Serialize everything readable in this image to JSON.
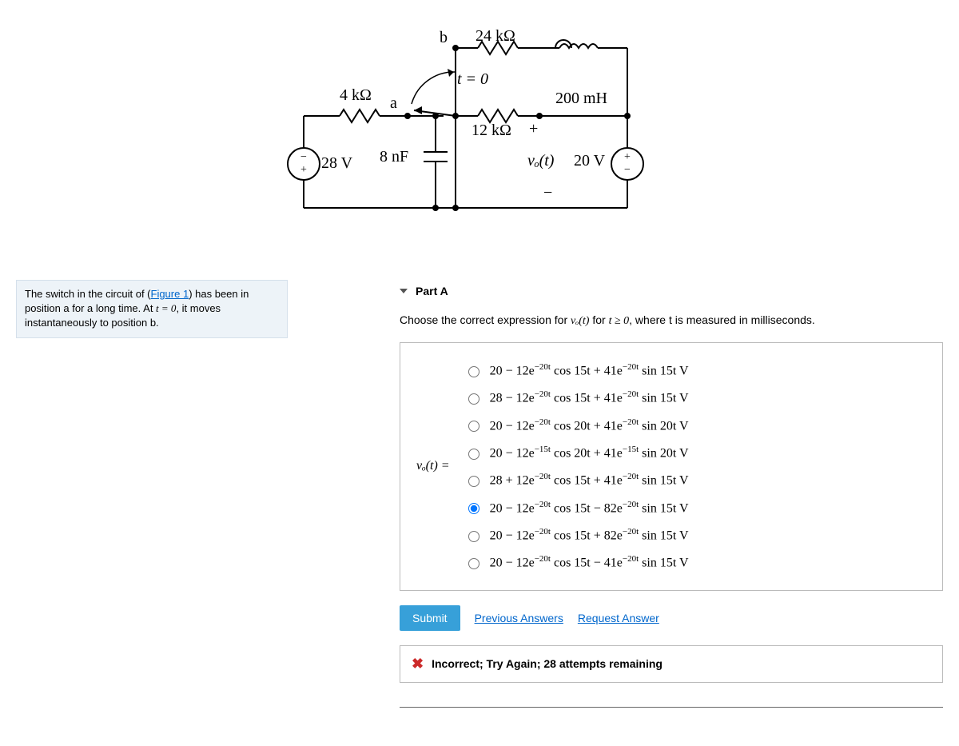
{
  "circuit": {
    "r1": "4 kΩ",
    "node_a": "a",
    "node_b": "b",
    "r_top": "24 kΩ",
    "switch_time": "t = 0",
    "r_mid": "12 kΩ",
    "inductor": "200 mH",
    "v_src_left": "28 V",
    "cap": "8 nF",
    "vo_label": "vₒ(t)",
    "v_src_right": "20 V",
    "plus": "+",
    "minus": "−"
  },
  "problem": {
    "prefix": "The switch in the circuit of (",
    "figure_link": "Figure 1",
    "middle": ") has been in position a for a long time. At ",
    "time_expr": "t = 0",
    "suffix": ", it moves instantaneously to position b."
  },
  "part": {
    "label": "Part A",
    "instruction_prefix": "Choose the correct expression for ",
    "instruction_vo": "vₒ(t)",
    "instruction_mid": " for ",
    "instruction_cond": "t ≥ 0",
    "instruction_suffix": ", where t is measured in milliseconds.",
    "lhs": "vₒ(t) ="
  },
  "options": [
    {
      "html": "20 − 12e<sup>−20t</sup> cos 15t + 41e<sup>−20t</sup> sin 15t V"
    },
    {
      "html": "28 − 12e<sup>−20t</sup> cos 15t + 41e<sup>−20t</sup> sin 15t V"
    },
    {
      "html": "20 − 12e<sup>−20t</sup> cos 20t + 41e<sup>−20t</sup> sin 20t V"
    },
    {
      "html": "20 − 12e<sup>−15t</sup> cos 20t + 41e<sup>−15t</sup> sin 20t V"
    },
    {
      "html": "28 + 12e<sup>−20t</sup> cos 15t + 41e<sup>−20t</sup> sin 15t V"
    },
    {
      "html": "20 − 12e<sup>−20t</sup> cos 15t − 82e<sup>−20t</sup> sin 15t V"
    },
    {
      "html": "20 − 12e<sup>−20t</sup> cos 15t + 82e<sup>−20t</sup> sin 15t V"
    },
    {
      "html": "20 − 12e<sup>−20t</sup> cos 15t − 41e<sup>−20t</sup> sin 15t V"
    }
  ],
  "selected_index": 5,
  "submit_label": "Submit",
  "prev_answers_label": "Previous Answers",
  "request_answer_label": "Request Answer",
  "feedback": "Incorrect; Try Again; 28 attempts remaining"
}
